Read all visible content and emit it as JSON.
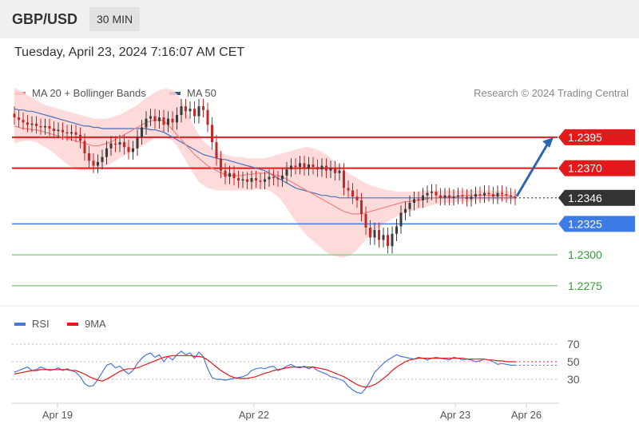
{
  "header": {
    "symbol": "GBP/USD",
    "interval": "30 MIN"
  },
  "datetime": "Tuesday, April 23, 2024 7:16:07 AM CET",
  "legend": {
    "ma20_label": "MA 20 + Bollinger Bands",
    "ma50_label": "MA 50",
    "credit": "Research © 2024 Trading Central"
  },
  "rsi_legend": {
    "rsi_label": "RSI",
    "ma_label": "9MA"
  },
  "colors": {
    "resistance": "#e31a1c",
    "pivot": "#3d7be6",
    "support": "#2e9e3a",
    "last": "#333333",
    "ma20": "#f08080",
    "ma50": "#4a6fb5",
    "band": "#fdd5d5",
    "arrow": "#2f64b3",
    "candle_up": "#3c3c3c",
    "candle_down": "#c62828"
  },
  "chart_data": [
    {
      "type": "candlestick",
      "title": "GBP/USD",
      "price_range": [
        1.2262,
        1.2422
      ],
      "x_ticks": [
        "Apr 19",
        "Apr 22",
        "Apr 23",
        "Apr 26"
      ],
      "levels": [
        {
          "name": "resistance-2",
          "value": 1.2395,
          "label": "1.2395",
          "kind": "resistance"
        },
        {
          "name": "resistance-1",
          "value": 1.237,
          "label": "1.2370",
          "kind": "resistance"
        },
        {
          "name": "last-price",
          "value": 1.2346,
          "label": "1.2346",
          "kind": "last"
        },
        {
          "name": "pivot",
          "value": 1.2325,
          "label": "1.2325",
          "kind": "pivot"
        },
        {
          "name": "support-1",
          "value": 1.23,
          "label": "1.2300",
          "kind": "support"
        },
        {
          "name": "support-2",
          "value": 1.2275,
          "label": "1.2275",
          "kind": "support"
        }
      ],
      "closes": [
        1.2411,
        1.2409,
        1.2407,
        1.2405,
        1.2406,
        1.2404,
        1.2403,
        1.2404,
        1.2402,
        1.24,
        1.2401,
        1.2399,
        1.2398,
        1.2399,
        1.2397,
        1.2392,
        1.2382,
        1.2376,
        1.2372,
        1.2375,
        1.2379,
        1.2386,
        1.239,
        1.2389,
        1.2391,
        1.2387,
        1.2383,
        1.2386,
        1.2395,
        1.2403,
        1.241,
        1.2412,
        1.2408,
        1.2411,
        1.2405,
        1.241,
        1.2407,
        1.2413,
        1.242,
        1.2416,
        1.2418,
        1.2412,
        1.242,
        1.2417,
        1.2405,
        1.2391,
        1.2378,
        1.2368,
        1.2363,
        1.2366,
        1.2362,
        1.236,
        1.2361,
        1.2359,
        1.2362,
        1.236,
        1.2359,
        1.2361,
        1.2363,
        1.2362,
        1.2361,
        1.2364,
        1.2369,
        1.2372,
        1.2371,
        1.2374,
        1.237,
        1.2373,
        1.2371,
        1.2369,
        1.2372,
        1.2368,
        1.237,
        1.2366,
        1.2368,
        1.2354,
        1.2352,
        1.2347,
        1.2344,
        1.2333,
        1.2322,
        1.2314,
        1.232,
        1.2312,
        1.2316,
        1.2307,
        1.2317,
        1.2323,
        1.2334,
        1.2337,
        1.2342,
        1.2345,
        1.2344,
        1.2348,
        1.235,
        1.2351,
        1.2348,
        1.2346,
        1.2348,
        1.2346,
        1.2347,
        1.2348,
        1.2347,
        1.2345,
        1.2347,
        1.2349,
        1.2348,
        1.235,
        1.2349,
        1.2347,
        1.235,
        1.2349,
        1.2348,
        1.2347,
        1.2346
      ],
      "ma20": [
        1.2404,
        1.2403,
        1.2402,
        1.2402,
        1.2401,
        1.2401,
        1.24,
        1.2399,
        1.2398,
        1.2397,
        1.2396,
        1.2395,
        1.2394,
        1.2393,
        1.2392,
        1.2391,
        1.239,
        1.2389,
        1.2388,
        1.2388,
        1.2389,
        1.239,
        1.2391,
        1.2393,
        1.2395,
        1.2397,
        1.2399,
        1.2401,
        1.2403,
        1.2405,
        1.2407,
        1.2408,
        1.2409,
        1.2409,
        1.2408,
        1.2405,
        1.2401,
        1.2397,
        1.2393,
        1.2389,
        1.2385,
        1.2381,
        1.2378,
        1.2375,
        1.2372,
        1.237,
        1.2368,
        1.2366,
        1.2365,
        1.2364,
        1.2364,
        1.2364,
        1.2364,
        1.2365,
        1.2365,
        1.2366,
        1.2366,
        1.2366,
        1.2366,
        1.2365,
        1.2364,
        1.2363,
        1.2361,
        1.2359,
        1.2357,
        1.2355,
        1.2353,
        1.2351,
        1.2349,
        1.2347,
        1.2345,
        1.2343,
        1.2341,
        1.2339,
        1.2337,
        1.2335,
        1.2334,
        1.2333,
        1.2333,
        1.2333,
        1.2334,
        1.2335,
        1.2336,
        1.2337,
        1.2338,
        1.2339,
        1.234,
        1.2341,
        1.2342,
        1.2343,
        1.2343,
        1.2344,
        1.2344,
        1.2345,
        1.2345,
        1.2346,
        1.2346,
        1.2347,
        1.2347,
        1.2347,
        1.2347,
        1.2347,
        1.2348,
        1.2348,
        1.2348,
        1.2348,
        1.2348,
        1.2348,
        1.2348,
        1.2348,
        1.2348,
        1.2348,
        1.2348,
        1.2347,
        1.2347
      ],
      "ma50": [
        1.2418,
        1.2417,
        1.2417,
        1.2416,
        1.2416,
        1.2415,
        1.2414,
        1.2413,
        1.2412,
        1.2411,
        1.241,
        1.2409,
        1.2408,
        1.2407,
        1.2406,
        1.2405,
        1.2404,
        1.2404,
        1.2403,
        1.2403,
        1.2402,
        1.2402,
        1.2402,
        1.2402,
        1.2402,
        1.2402,
        1.2402,
        1.2402,
        1.2402,
        1.2402,
        1.2402,
        1.2401,
        1.2401,
        1.24,
        1.2399,
        1.2397,
        1.2395,
        1.2393,
        1.2391,
        1.2389,
        1.2387,
        1.2385,
        1.2383,
        1.2381,
        1.238,
        1.2379,
        1.2378,
        1.2377,
        1.2377,
        1.2376,
        1.2375,
        1.2374,
        1.2373,
        1.2372,
        1.2371,
        1.237,
        1.2369,
        1.2368,
        1.2366,
        1.2364,
        1.2362,
        1.236,
        1.2358,
        1.2356,
        1.2354,
        1.2353,
        1.2352,
        1.2351,
        1.235,
        1.2349,
        1.2348,
        1.2348,
        1.2347,
        1.2347,
        1.2346,
        1.2346,
        1.2346,
        1.2346,
        1.2346,
        1.2346,
        1.2346,
        1.2346,
        1.2346,
        1.2346,
        1.2346,
        1.2346,
        1.2346,
        1.2346,
        1.2346,
        1.2346,
        1.2346,
        1.2346,
        1.2346,
        1.2346,
        1.2346,
        1.2346,
        1.2346,
        1.2346,
        1.2346,
        1.2346,
        1.2346,
        1.2346,
        1.2346,
        1.2346,
        1.2346,
        1.2346,
        1.2346,
        1.2346,
        1.2346,
        1.2346,
        1.2346,
        1.2346,
        1.2346,
        1.2346,
        1.2346
      ],
      "band_upper": [
        1.2435,
        1.2433,
        1.2431,
        1.2429,
        1.2427,
        1.2425,
        1.2423,
        1.2421,
        1.242,
        1.2419,
        1.2418,
        1.2417,
        1.2416,
        1.2415,
        1.2414,
        1.2413,
        1.2412,
        1.2411,
        1.241,
        1.241,
        1.241,
        1.241,
        1.2411,
        1.2412,
        1.2413,
        1.2415,
        1.2417,
        1.2419,
        1.2421,
        1.2424,
        1.2427,
        1.2429,
        1.2431,
        1.2433,
        1.2434,
        1.2434,
        1.2433,
        1.243,
        1.2425,
        1.2418,
        1.241,
        1.2403,
        1.2397,
        1.2392,
        1.2389,
        1.2386,
        1.2384,
        1.2382,
        1.2381,
        1.238,
        1.2379,
        1.2379,
        1.2379,
        1.2378,
        1.2378,
        1.2378,
        1.2378,
        1.2378,
        1.2379,
        1.238,
        1.2381,
        1.2382,
        1.2383,
        1.2384,
        1.2385,
        1.2386,
        1.2387,
        1.2387,
        1.2386,
        1.2385,
        1.2383,
        1.2381,
        1.2378,
        1.2375,
        1.2372,
        1.2369,
        1.2366,
        1.2364,
        1.2362,
        1.236,
        1.2358,
        1.2356,
        1.2355,
        1.2354,
        1.2353,
        1.2352,
        1.2352,
        1.2351,
        1.2351,
        1.2351,
        1.2351,
        1.2351,
        1.2351,
        1.2352,
        1.2352,
        1.2352,
        1.2352,
        1.2352,
        1.2352,
        1.2352,
        1.2352,
        1.2352,
        1.2352,
        1.2352,
        1.2352,
        1.2352,
        1.2352,
        1.2352,
        1.2352,
        1.2352,
        1.2352,
        1.2352,
        1.2352,
        1.2351,
        1.2351
      ],
      "band_lower": [
        1.239,
        1.2391,
        1.2392,
        1.2392,
        1.2392,
        1.2391,
        1.2389,
        1.2387,
        1.2385,
        1.2382,
        1.2379,
        1.2376,
        1.2373,
        1.2371,
        1.2369,
        1.2368,
        1.2368,
        1.2368,
        1.2369,
        1.237,
        1.2371,
        1.2372,
        1.2374,
        1.2376,
        1.2378,
        1.238,
        1.2382,
        1.2384,
        1.2386,
        1.2388,
        1.239,
        1.2392,
        1.2394,
        1.2395,
        1.2395,
        1.2394,
        1.2392,
        1.2388,
        1.2382,
        1.2376,
        1.237,
        1.2364,
        1.2359,
        1.2356,
        1.2354,
        1.2353,
        1.2352,
        1.2352,
        1.2352,
        1.2352,
        1.2352,
        1.2352,
        1.2352,
        1.2352,
        1.2352,
        1.2353,
        1.2353,
        1.2353,
        1.2352,
        1.235,
        1.2347,
        1.2343,
        1.2338,
        1.2332,
        1.2327,
        1.2322,
        1.2318,
        1.2314,
        1.2311,
        1.2308,
        1.2305,
        1.2302,
        1.23,
        1.2299,
        1.2298,
        1.2298,
        1.2299,
        1.2301,
        1.2304,
        1.2308,
        1.2312,
        1.2316,
        1.2319,
        1.2322,
        1.2325,
        1.2327,
        1.2329,
        1.2331,
        1.2332,
        1.2334,
        1.2335,
        1.2336,
        1.2337,
        1.2338,
        1.2339,
        1.234,
        1.2341,
        1.2341,
        1.2342,
        1.2342,
        1.2342,
        1.2343,
        1.2343,
        1.2343,
        1.2343,
        1.2344,
        1.2344,
        1.2344,
        1.2344,
        1.2344,
        1.2344,
        1.2344,
        1.2344,
        1.2344,
        1.2344
      ]
    },
    {
      "type": "line",
      "title": "RSI",
      "ylim": [
        10,
        80
      ],
      "y_ticks": [
        "70",
        "50",
        "30"
      ],
      "series": [
        {
          "name": "RSI",
          "values": [
            38,
            40,
            42,
            44,
            40,
            41,
            44,
            42,
            40,
            41,
            43,
            40,
            42,
            40,
            38,
            33,
            25,
            22,
            23,
            30,
            38,
            46,
            48,
            43,
            45,
            40,
            36,
            40,
            48,
            54,
            58,
            60,
            55,
            58,
            50,
            56,
            52,
            58,
            62,
            58,
            60,
            54,
            61,
            56,
            42,
            32,
            30,
            30,
            29,
            30,
            31,
            32,
            33,
            35,
            40,
            42,
            43,
            42,
            44,
            45,
            40,
            42,
            45,
            47,
            44,
            43,
            45,
            42,
            44,
            40,
            38,
            36,
            33,
            32,
            30,
            28,
            22,
            18,
            15,
            14,
            20,
            28,
            38,
            43,
            48,
            52,
            55,
            58,
            56,
            55,
            54,
            53,
            55,
            54,
            52,
            54,
            55,
            54,
            53,
            52,
            55,
            54,
            52,
            53,
            52,
            50,
            51,
            53,
            52,
            50,
            47,
            48,
            47,
            46,
            46
          ]
        },
        {
          "name": "9MA",
          "values": [
            36,
            37,
            38,
            39,
            40,
            40,
            41,
            41,
            41,
            41,
            41,
            41,
            41,
            40,
            40,
            38,
            36,
            33,
            31,
            29,
            28,
            30,
            33,
            36,
            39,
            41,
            42,
            42,
            43,
            45,
            47,
            49,
            51,
            53,
            55,
            56,
            57,
            57,
            57,
            57,
            57,
            56,
            56,
            55,
            52,
            48,
            44,
            40,
            37,
            34,
            32,
            31,
            31,
            31,
            32,
            33,
            35,
            37,
            38,
            40,
            41,
            42,
            43,
            44,
            44,
            44,
            44,
            44,
            44,
            43,
            42,
            41,
            39,
            37,
            35,
            33,
            30,
            27,
            24,
            22,
            21,
            22,
            24,
            27,
            31,
            35,
            40,
            44,
            47,
            50,
            52,
            53,
            54,
            54,
            54,
            54,
            54,
            54,
            54,
            54,
            54,
            54,
            54,
            53,
            53,
            53,
            53,
            53,
            52,
            52,
            51,
            51,
            50,
            50,
            50
          ]
        }
      ]
    }
  ]
}
